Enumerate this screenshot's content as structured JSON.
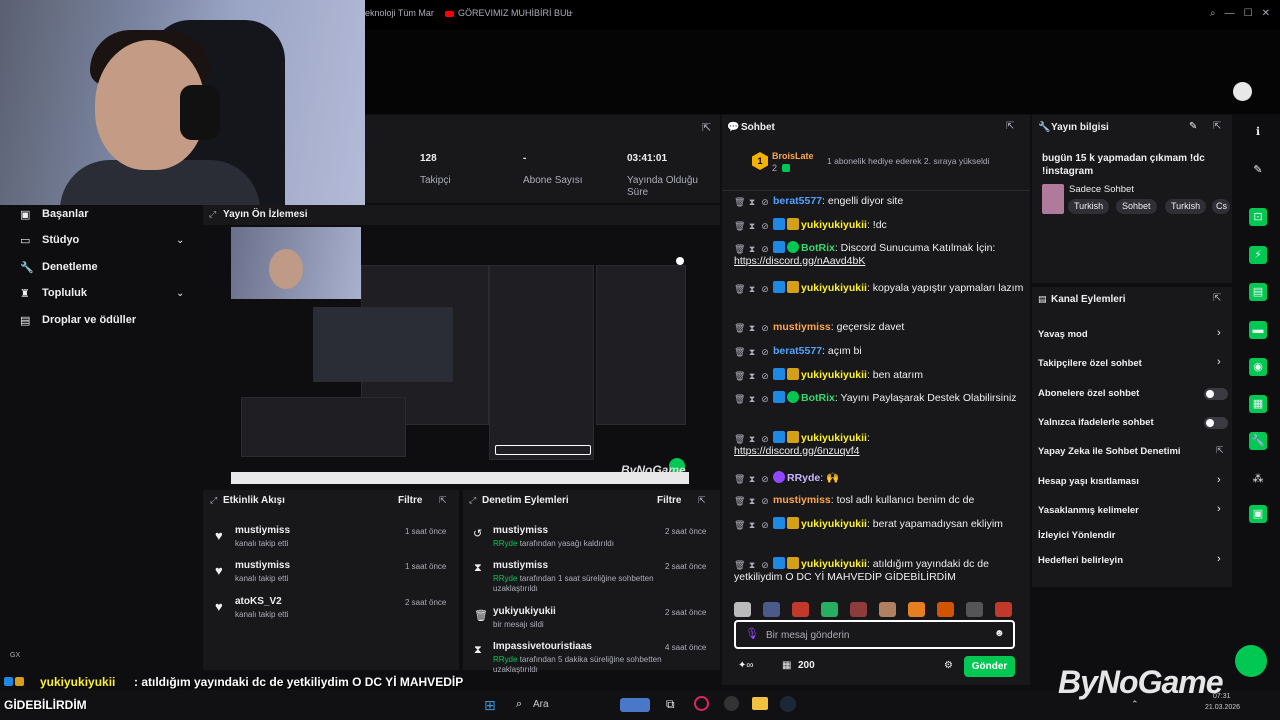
{
  "browser": {
    "tabs": [
      {
        "label": "eknoloji Tüm Mar"
      },
      {
        "label": "GÖREVIMIZ MUHİBİRİ BUL"
      }
    ],
    "new_tab": "+"
  },
  "stats": {
    "followers_value": "128",
    "followers_label": "Takipçi",
    "subs_value": "-",
    "subs_label": "Abone Sayısı",
    "uptime_value": "03:41:01",
    "uptime_label": "Yayında Olduğu Süre"
  },
  "nav": {
    "items": [
      {
        "label": "Başanlar"
      },
      {
        "label": "Stüdyo"
      },
      {
        "label": "Denetleme"
      },
      {
        "label": "Topluluk"
      },
      {
        "label": "Droplar ve ödüller"
      }
    ]
  },
  "preview": {
    "title": "Yayın Ön İzlemesi",
    "watermark": "ByNoGame"
  },
  "activity": {
    "title": "Etkinlik Akışı",
    "filter": "Filtre",
    "items": [
      {
        "name": "mustiymiss",
        "desc": "kanalı takip etti",
        "time": "1 saat önce"
      },
      {
        "name": "mustiymiss",
        "desc": "kanalı takip etti",
        "time": "1 saat önce"
      },
      {
        "name": "atoKS_V2",
        "desc": "kanalı takip etti",
        "time": "2 saat önce"
      }
    ]
  },
  "mod_actions": {
    "title": "Denetim Eylemleri",
    "filter": "Filtre",
    "items": [
      {
        "name": "mustiymiss",
        "actor": "RRyde",
        "desc": "tarafından yasağı kaldırıldı",
        "time": "2 saat önce"
      },
      {
        "name": "mustiymiss",
        "actor": "RRyde",
        "desc": "tarafından 1 saat süreliğine sohbetten uzaklaştırıldı",
        "time": "2 saat önce"
      },
      {
        "name": "yukiyukiyukii",
        "actor": "",
        "desc": "bir mesajı sildi",
        "time": "2 saat önce"
      },
      {
        "name": "Impassivetouristiaas",
        "actor": "RRyde",
        "desc": "tarafından 5 dakika süreliğine sohbetten uzaklaştırıldı",
        "time": "4 saat önce"
      }
    ]
  },
  "chat": {
    "title": "Sohbet",
    "pinned": {
      "user": "BroisLate",
      "count": "2",
      "text": "1 abonelik hediye ederek 2. sıraya yükseldi"
    },
    "messages": [
      {
        "user": "berat5577",
        "text": ": engelli diyor site"
      },
      {
        "user": "yukiyukiyukii",
        "text": ": !dc"
      },
      {
        "user": "BotRix",
        "text": ": Discord Sunucuma Katılmak İçin: ",
        "link": "https://discord.gg/nAavd4bK"
      },
      {
        "user": "yukiyukiyukii",
        "text": ": kopyala yapıştır yapmaları lazım"
      },
      {
        "user": "mustiymiss",
        "text": ": geçersiz davet"
      },
      {
        "user": "berat5577",
        "text": ": açım bi"
      },
      {
        "user": "yukiyukiyukii",
        "text": ": ben atarım"
      },
      {
        "user": "BotRix",
        "text": ": Yayını Paylaşarak Destek Olabilirsiniz"
      },
      {
        "user": "yukiyukiyukii",
        "text": ":",
        "link": "https://discord.gg/6nzuqvf4"
      },
      {
        "user": "RRyde",
        "text": ": 🙌"
      },
      {
        "user": "mustiymiss",
        "text": ": tosl adlı kullanıcı benim dc de"
      },
      {
        "user": "yukiyukiyukii",
        "text": ": berat yapamadıysan ekliyim"
      },
      {
        "user": "yukiyukiyukii",
        "text": ": atıldığım yayındaki dc de yetkiliydim O DC Yİ MAHVEDİP GİDEBİLİRDİM"
      }
    ],
    "input_placeholder": "Bir mesaj gönderin",
    "points": "200",
    "send": "Gönder"
  },
  "stream_info": {
    "title": "Yayın bilgisi",
    "stream_title": "bugün 15 k yapmadan çıkmam !dc !instagram",
    "category": "Sadece Sohbet",
    "tags": [
      "Turkish",
      "Sohbet",
      "Turkish",
      "Cs"
    ]
  },
  "channel_actions": {
    "title": "Kanal Eylemleri",
    "items": [
      {
        "label": "Yavaş mod"
      },
      {
        "label": "Takipçilere özel sohbet"
      },
      {
        "label": "Abonelere özel sohbet"
      },
      {
        "label": "Yalnızca ifadelerle sohbet"
      },
      {
        "label": "Yapay Zeka ile Sohbet Denetimi"
      },
      {
        "label": "Hesap yaşı kısıtlaması"
      },
      {
        "label": "Yasaklanmış kelimeler"
      },
      {
        "label": "İzleyici Yönlendir"
      },
      {
        "label": "Hedefleri belirleyin"
      }
    ]
  },
  "overlay": {
    "user": "yukiyukiyukii",
    "text": ": atıldığım yayındaki dc de yetkiliydim O DC Yİ MAHVEDİP",
    "text2": "GİDEBİLİRDİM",
    "gx": "GX"
  },
  "taskbar": {
    "search": "Ara",
    "time": "07:31",
    "date": "21.03.2026"
  },
  "brand": "ByNoGame"
}
